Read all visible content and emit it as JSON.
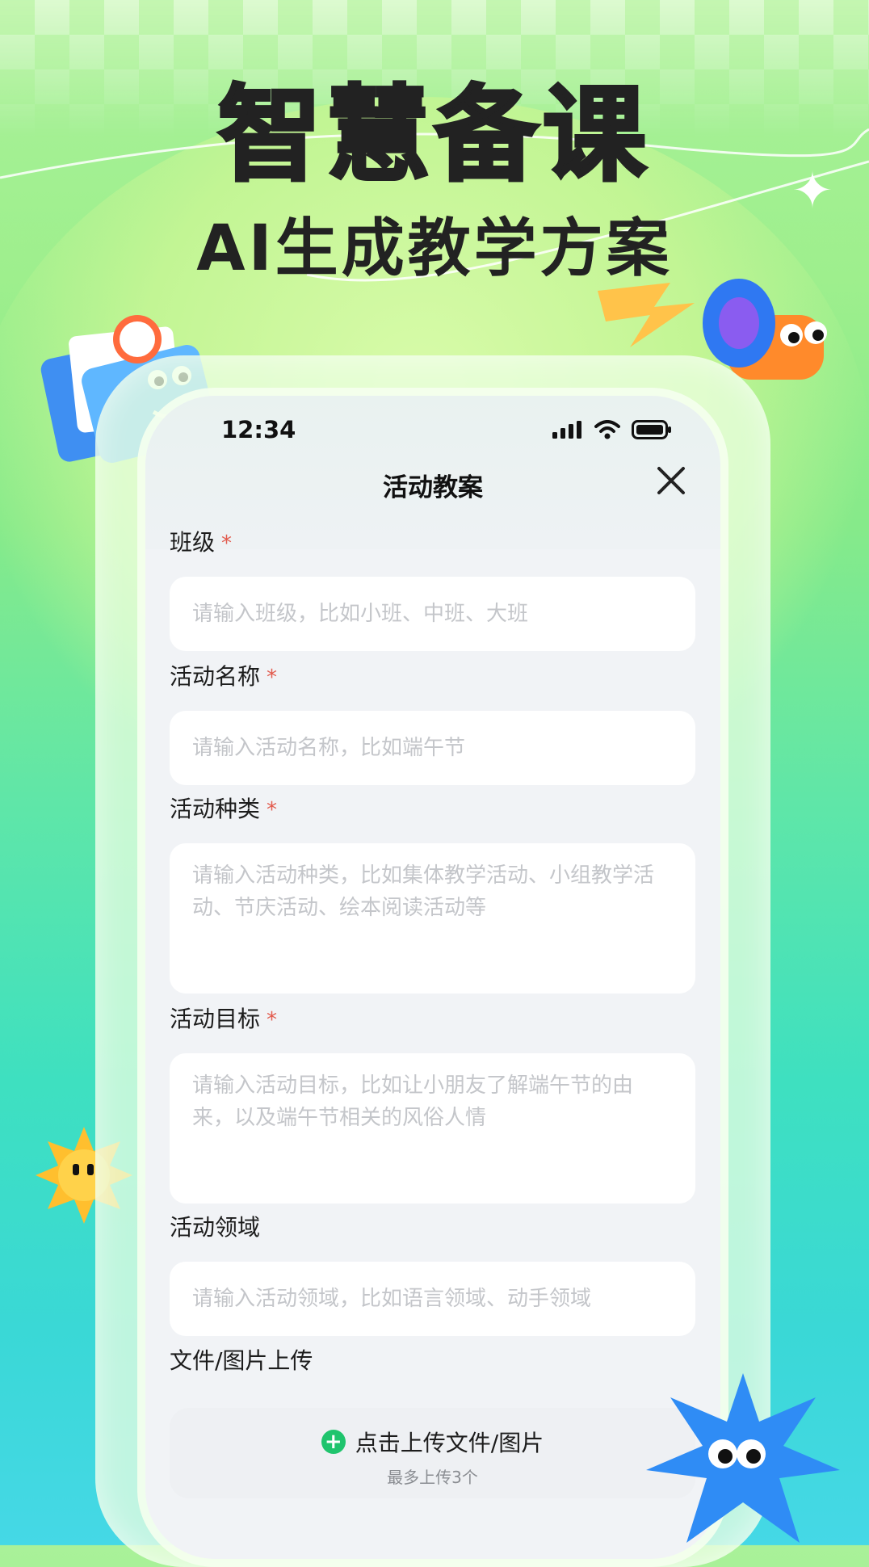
{
  "hero": {
    "title": "智慧备课",
    "subtitle": "AI生成教学方案"
  },
  "status_bar": {
    "time": "12:34"
  },
  "nav": {
    "title": "活动教案",
    "close_icon": "close-icon"
  },
  "form": {
    "required_mark": "*",
    "fields": [
      {
        "label": "班级",
        "required": true,
        "placeholder": "请输入班级，比如小班、中班、大班"
      },
      {
        "label": "活动名称",
        "required": true,
        "placeholder": "请输入活动名称，比如端午节"
      },
      {
        "label": "活动种类",
        "required": true,
        "placeholder": "请输入活动种类，比如集体教学活动、小组教学活动、节庆活动、绘本阅读活动等"
      },
      {
        "label": "活动目标",
        "required": true,
        "placeholder": "请输入活动目标，比如让小朋友了解端午节的由来，以及端午节相关的风俗人情"
      },
      {
        "label": "活动领域",
        "required": false,
        "placeholder": "请输入活动领域，比如语言领域、动手领域"
      }
    ],
    "upload": {
      "label": "文件/图片上传",
      "button_text": "点击上传文件/图片",
      "limit_text": "最多上传3个"
    }
  },
  "colors": {
    "accent_green": "#1fc46d",
    "required_red": "#e25b4e"
  },
  "icons": [
    "signal-icon",
    "wifi-icon",
    "battery-icon",
    "close-icon",
    "plus-circle-icon",
    "sparkle-icon"
  ]
}
